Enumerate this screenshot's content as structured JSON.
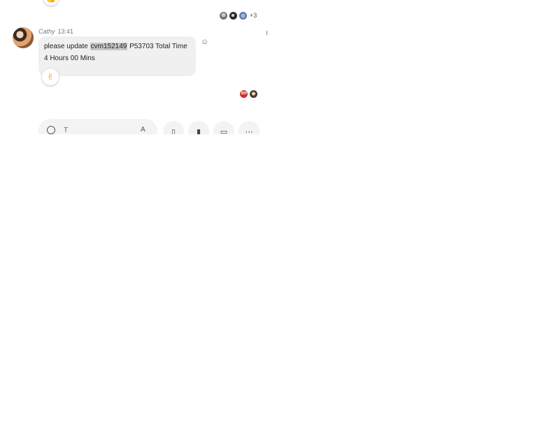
{
  "message": {
    "sender": "Cathy",
    "time": "13:41",
    "line1_prefix": "please update ",
    "line1_highlight": "cvm152149",
    "line1_suffix": " P53703  Total Time",
    "line2": "4 Hours 00 Mins"
  },
  "reactions": {
    "top_partial": "👍",
    "message_reaction": "✌"
  },
  "receipts_top": {
    "more_label": "+3"
  },
  "receipts_bottom": {
    "badge_text": "SH"
  },
  "composer": {
    "text": "T"
  },
  "icons": [
    "emoji-icon",
    "format-icon",
    "attach-icon",
    "mic-icon",
    "video-icon",
    "more-icon"
  ],
  "colors": {
    "bubble_bg": "#f0f0f0",
    "highlight_bg": "#c8c8c8",
    "badge_red": "#c9302c"
  }
}
